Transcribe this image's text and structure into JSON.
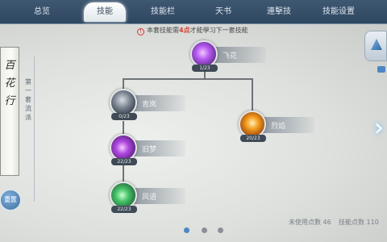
{
  "tabs": [
    {
      "label": "总览",
      "active": false
    },
    {
      "label": "技能",
      "active": true
    },
    {
      "label": "技能栏",
      "active": false
    },
    {
      "label": "天书",
      "active": false
    },
    {
      "label": "連擊技",
      "active": false
    },
    {
      "label": "技能设置",
      "active": false
    }
  ],
  "notice": {
    "prefix": "本套技能需",
    "points": "4点",
    "suffix": "才能學习下一套技能"
  },
  "scroll_title": "百花行",
  "side_label": "第一套流派",
  "reset_label": "重置",
  "skills": [
    {
      "name": "飞花",
      "level": "1/23",
      "color": "orb-pink"
    },
    {
      "name": "青岚",
      "level": "0/23",
      "color": "orb-dark"
    },
    {
      "name": "烈焰",
      "level": "20/23",
      "color": "orb-fire"
    },
    {
      "name": "旧梦",
      "level": "22/23",
      "color": "orb-purple"
    },
    {
      "name": "风语",
      "level": "22/23",
      "color": "orb-green"
    }
  ],
  "page": {
    "current": 1,
    "total": 3
  },
  "footer": {
    "points_label": "未使用点數 46",
    "extra_label": "技能点数 110"
  },
  "colors": {
    "accent": "#4d86c4",
    "warning": "#e03a2f",
    "tab_bar": "#3f5872"
  }
}
